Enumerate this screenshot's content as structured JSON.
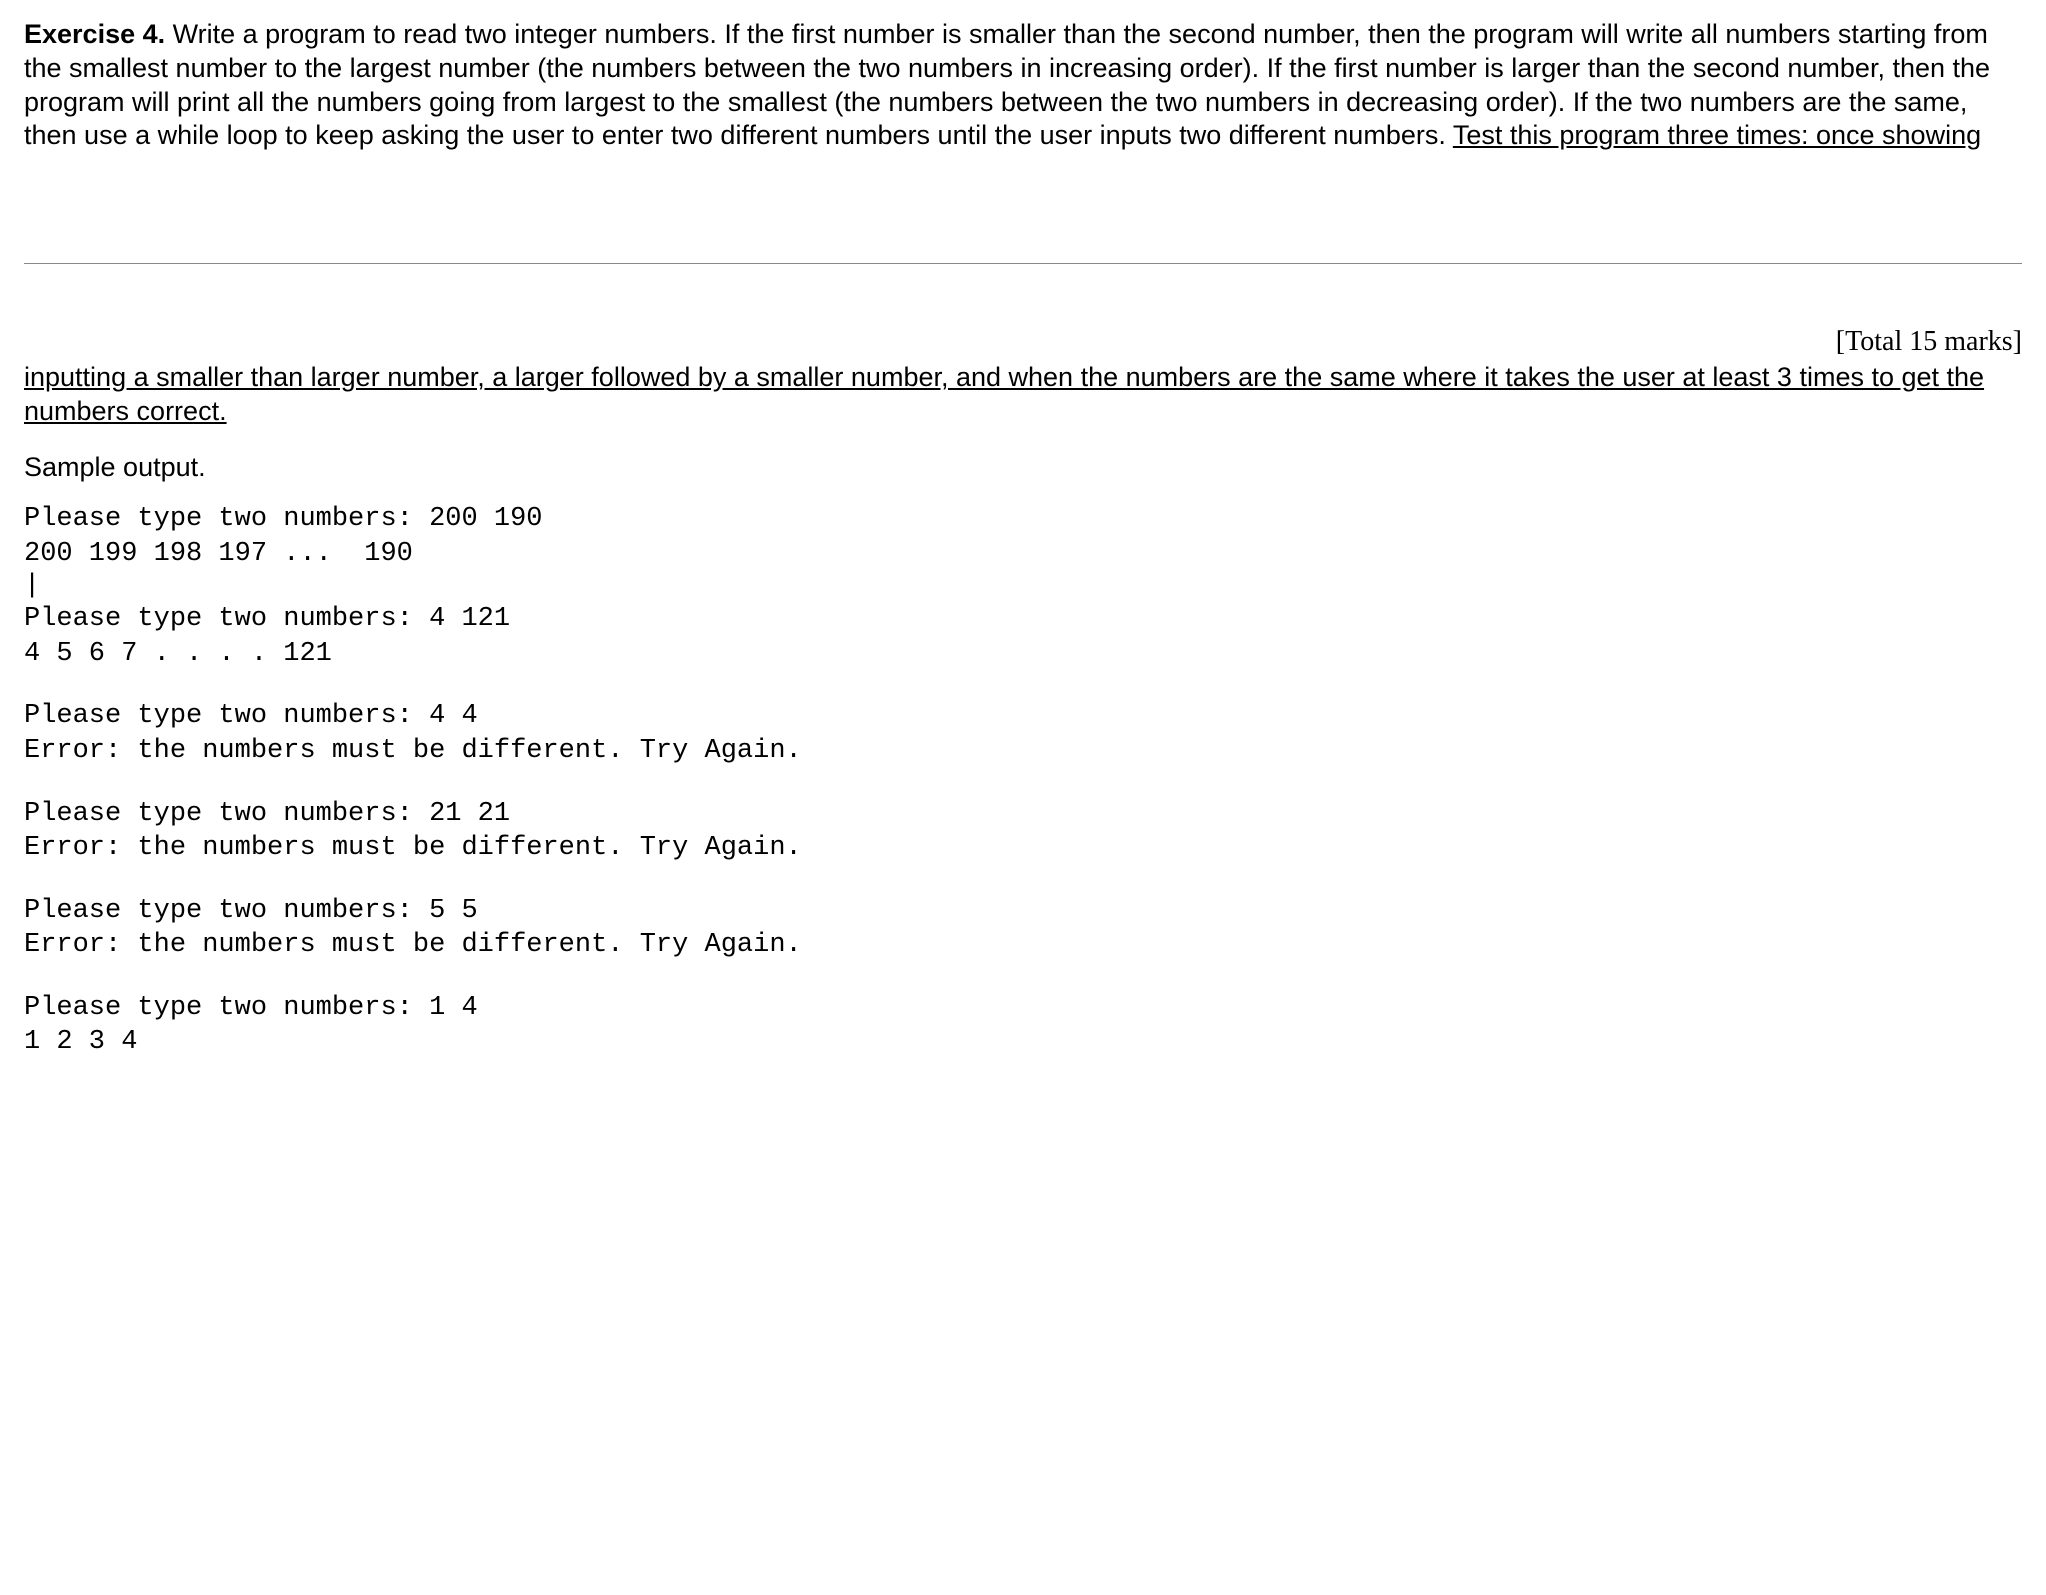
{
  "exercise": {
    "label": "Exercise 4.",
    "body_part1": " Write a program to read two integer numbers. If the first number is smaller than the second number, then the program will write all numbers starting from the smallest number to the largest number (the numbers between the two numbers in increasing order). If the first number is larger than the second number, then the program will print all the numbers going from largest to the smallest (the numbers between the two numbers in decreasing order). If the two numbers are the same, then use a while loop to keep asking the user to enter two different numbers until the user inputs two different numbers. ",
    "underlined_part1": "Test this program three times: once showing"
  },
  "marks": "[Total 15 marks]",
  "continuation": {
    "underlined": "inputting a smaller than larger number, a larger followed by a smaller number, and when the numbers are the same where it takes the user at least 3 times to get the numbers correct."
  },
  "sample_label": "Sample output.",
  "samples": {
    "run1_line1": "Please type two numbers: 200 190",
    "run1_line2": "200 199 198 197 ...  190",
    "cursor": "|",
    "run2_line1": "Please type two numbers: 4 121",
    "run2_line2": "4 5 6 7 . . . . 121",
    "run3_line1": "Please type two numbers: 4 4",
    "run3_line2": "Error: the numbers must be different. Try Again.",
    "run4_line1": "Please type two numbers: 21 21",
    "run4_line2": "Error: the numbers must be different. Try Again.",
    "run5_line1": "Please type two numbers: 5 5",
    "run5_line2": "Error: the numbers must be different. Try Again.",
    "run6_line1": "Please type two numbers: 1 4",
    "run6_line2": "1 2 3 4"
  }
}
